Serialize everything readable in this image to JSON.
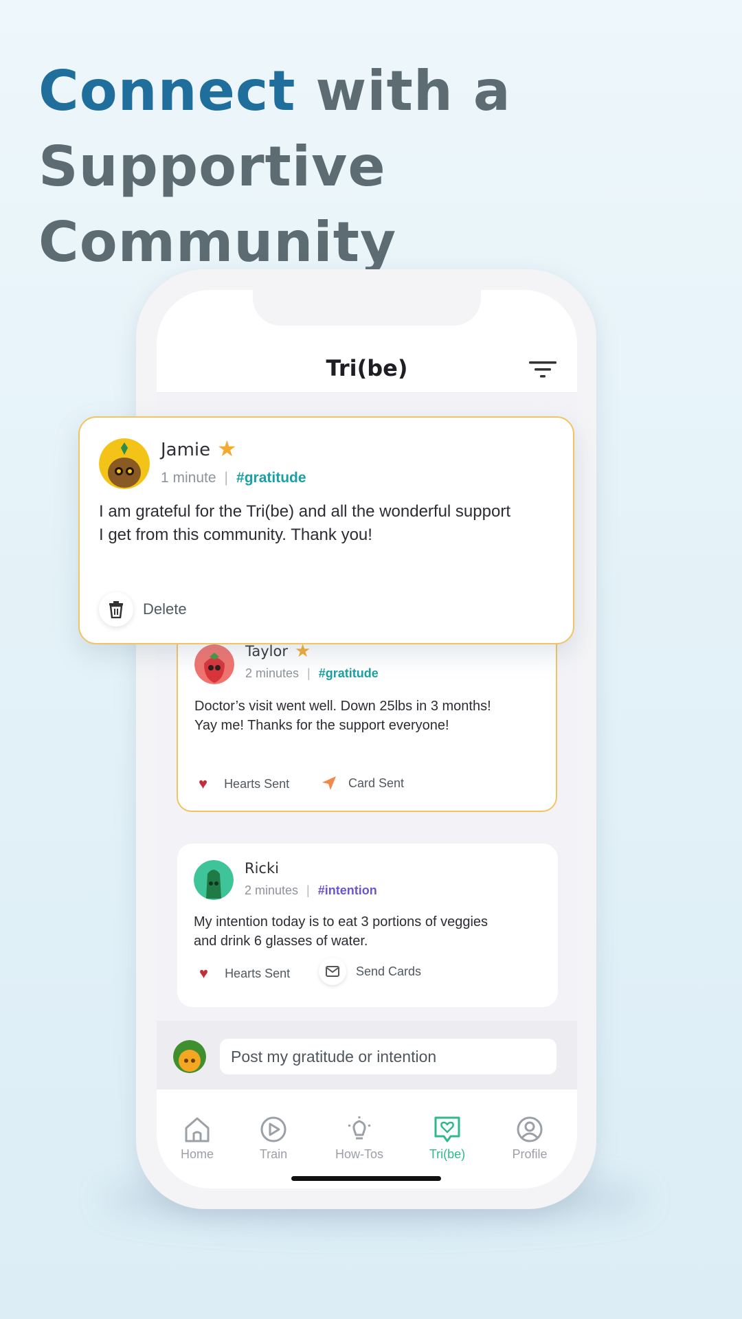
{
  "headline": {
    "accent": "Connect",
    "rest_line1": " with a",
    "line2": "Supportive Community"
  },
  "app": {
    "title": "Tri(be)"
  },
  "posts": [
    {
      "name": "Jamie",
      "time": "1 minute",
      "tag": "#gratitude",
      "text": "I am grateful for the Tri(be) and all the wonderful support I get from this community. Thank you!",
      "action": "Delete",
      "starred": true,
      "avatar": "pineapple-avatar"
    },
    {
      "name": "Taylor",
      "time": "2 minutes",
      "tag": "#gratitude",
      "text": "Doctor’s visit went well. Down 25lbs in 3 months! Yay me! Thanks for the support everyone!",
      "actions": [
        "Hearts Sent",
        "Card Sent"
      ],
      "starred": true,
      "avatar": "strawberry-avatar"
    },
    {
      "name": "Ricki",
      "time": "2 minutes",
      "tag": "#intention",
      "text": "My intention today is to eat 3 portions of veggies and drink 6 glasses of water.",
      "actions": [
        "Hearts Sent",
        "Send Cards"
      ],
      "starred": false,
      "avatar": "cucumber-avatar"
    }
  ],
  "composer": {
    "placeholder": "Post my gratitude or intention"
  },
  "tabs": [
    {
      "label": "Home",
      "icon": "home-icon"
    },
    {
      "label": "Train",
      "icon": "play-icon"
    },
    {
      "label": "How-Tos",
      "icon": "lightbulb-icon"
    },
    {
      "label": "Tri(be)",
      "icon": "heart-message-icon",
      "active": true
    },
    {
      "label": "Profile",
      "icon": "user-icon"
    }
  ],
  "colors": {
    "accent": "#1f6e9c",
    "gold": "#f0c463",
    "tag_gratitude": "#1aa0a4",
    "tag_intention": "#6b55d1",
    "active_tab": "#2fb98a"
  }
}
